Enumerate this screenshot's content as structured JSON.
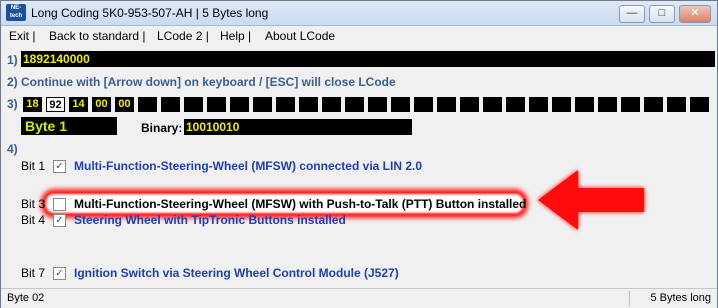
{
  "window": {
    "title": "Long Coding  5K0-953-507-AH | 5 Bytes long",
    "logo_text": "NE-tech",
    "minimize_glyph": "—",
    "maximize_glyph": "□",
    "close_glyph": "✕"
  },
  "menu": [
    {
      "label": "Exit |"
    },
    {
      "label": "Back to standard |"
    },
    {
      "label": "LCode 2 |"
    },
    {
      "label": "Help |"
    },
    {
      "label": "About LCode"
    }
  ],
  "step1": {
    "label": "1)",
    "value": "1892140000"
  },
  "step2": {
    "label": "2) Continue with [Arrow down] on keyboard / [ESC] will close LCode"
  },
  "step3": {
    "label": "3)",
    "bytes": [
      "18",
      "92",
      "14",
      "00",
      "00"
    ],
    "selected_byte": 1
  },
  "byte_info": {
    "byte_label": "Byte 1",
    "binary_label": "Binary:",
    "binary_value": "10010010"
  },
  "step4": {
    "label": "4)"
  },
  "bits": [
    {
      "bit": "Bit 1",
      "checked": true,
      "text": "Multi-Function-Steering-Wheel (MFSW) connected via LIN 2.0"
    },
    {
      "bit": "Bit 3",
      "checked": false,
      "text": "Multi-Function-Steering-Wheel (MFSW) with Push-to-Talk (PTT) Button installed"
    },
    {
      "bit": "Bit 4",
      "checked": true,
      "text": "Steering Wheel with TipTronic Buttons installed"
    },
    {
      "bit": "Bit 7",
      "checked": true,
      "text": "Ignition Switch via Steering Wheel Control Module (J527)"
    }
  ],
  "status": {
    "left": "Byte 02",
    "right": "5 Bytes long"
  },
  "colors": {
    "accent_text": "#1f3fb3",
    "field_bg": "#000000",
    "field_text": "#f2ee00",
    "annotation": "#ff1a1a"
  }
}
